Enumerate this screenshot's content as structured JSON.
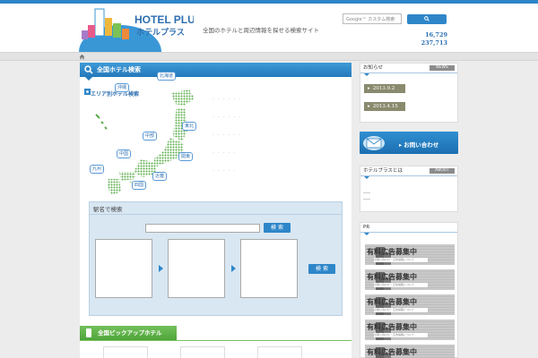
{
  "header": {
    "logo_en": "HOTEL PLUS",
    "logo_ja": "ホテルプラス",
    "tagline": "全国のホテルと周辺情報を探せる検索サイト",
    "search_placeholder": "Google™ カスタム検索",
    "counters": [
      "16,729",
      "237,713"
    ]
  },
  "main": {
    "hotel_search_title": "全国ホテル検索",
    "area_search_label": "エリア別ホテル検索",
    "regions": [
      "北海道",
      "沖縄",
      "東北",
      "中部",
      "中国",
      "関東",
      "九州",
      "近畿",
      "四国"
    ],
    "station": {
      "title": "駅名で検索",
      "search_button": "検 索",
      "go_button": "検 索"
    },
    "pickup_title": "全国ピックアップホテル"
  },
  "sidebar": {
    "news": {
      "title": "お知らせ",
      "tag": "NEWS",
      "items": [
        "2013.9.2",
        "2013.4.15"
      ]
    },
    "contact_label": "お問い合わせ",
    "about": {
      "title": "ホテルプラスとは",
      "tag": "ABOUT"
    },
    "pr": {
      "title": "PR",
      "ad_title": "有料広告募集中",
      "ad_sub": "お問い合わせ・広告掲載について",
      "ad_count": 5
    }
  },
  "colors": {
    "primary": "#2e86c9",
    "green": "#4ea53a",
    "news_item": "#8a8a6e"
  }
}
